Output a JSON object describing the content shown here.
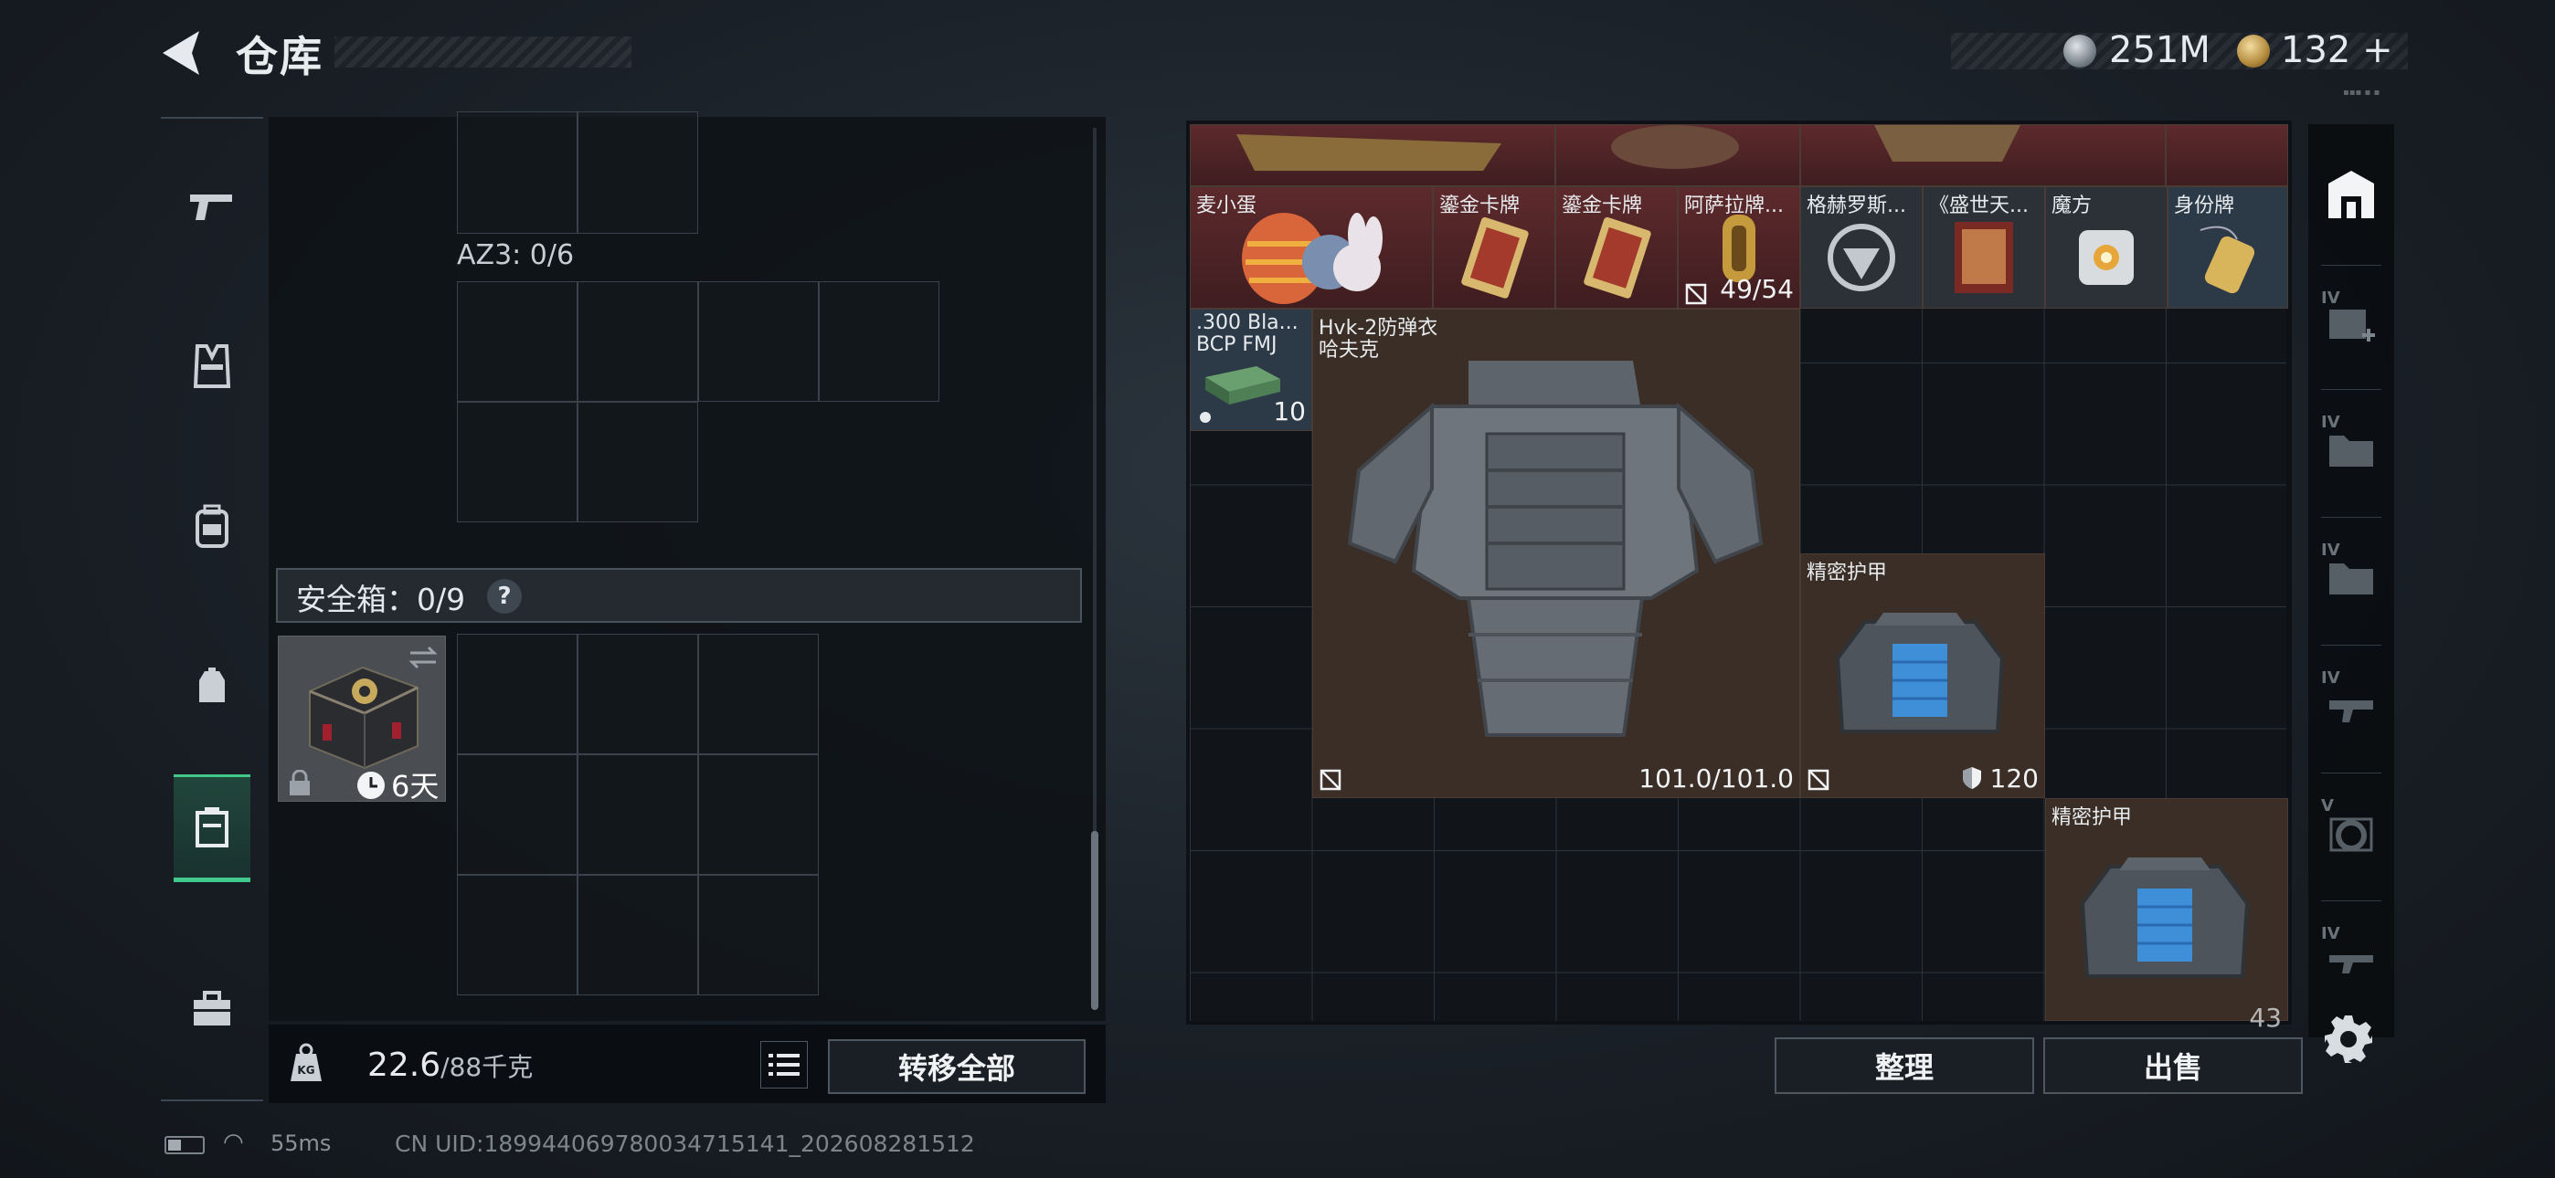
{
  "header": {
    "title": "仓库",
    "currency_1": "251M",
    "currency_2": "132",
    "currency_2_add": "+"
  },
  "left": {
    "az3_label": "AZ3: 0/6",
    "safe_label": "安全箱：0/9",
    "safe_help": "?",
    "safe_item_time": "6天",
    "weight_value": "22.6",
    "weight_max": "/88千克",
    "transfer_all": "转移全部"
  },
  "status": {
    "ping": "55ms",
    "uid": "CN UID:18994406978003471514​1_202608281512"
  },
  "right": {
    "items": [
      {
        "name": "麦小蛋"
      },
      {
        "name": "鎏金卡牌"
      },
      {
        "name": "鎏金卡牌"
      },
      {
        "name": "阿萨拉牌...",
        "count": "49/54"
      },
      {
        "name": "格赫罗斯..."
      },
      {
        "name": "《盛世天..."
      },
      {
        "name": "魔方"
      },
      {
        "name": "身份牌"
      },
      {
        "name": ".300 Bla...",
        "sub": "BCP FMJ",
        "count": "10"
      },
      {
        "name": "Hvk-2防弹衣",
        "sub": "哈夫克",
        "durability": "101.0/101.0"
      },
      {
        "name": "精密护甲",
        "armor": "120"
      },
      {
        "name": "精密护甲",
        "count": "43"
      }
    ],
    "tidy": "整理",
    "sell": "出售"
  },
  "side_tabs": [
    "IV",
    "IV",
    "IV",
    "IV",
    "V",
    "IV"
  ]
}
